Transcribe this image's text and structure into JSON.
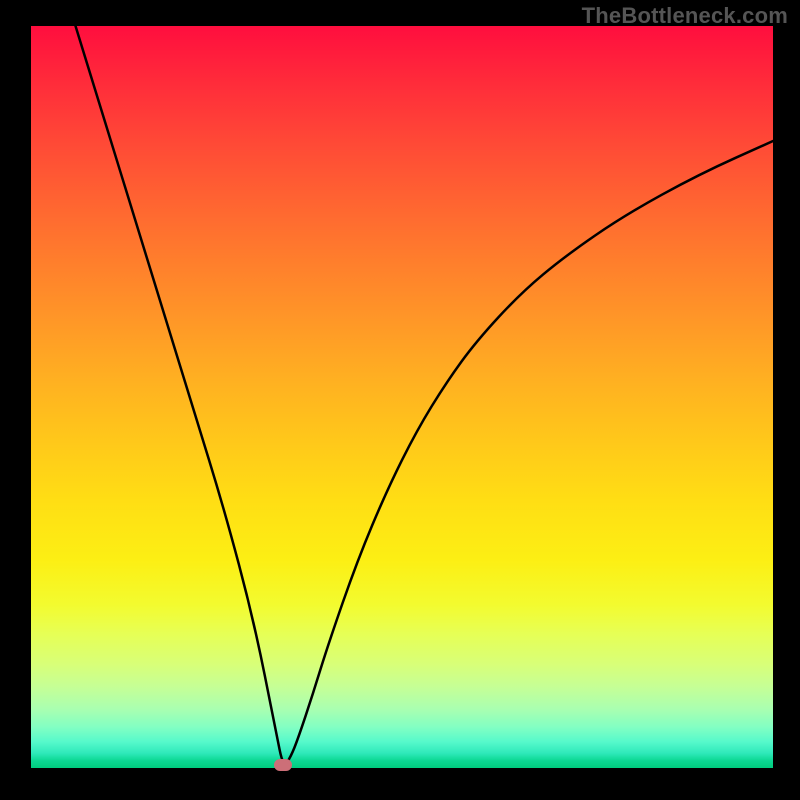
{
  "watermark": "TheBottleneck.com",
  "chart_data": {
    "type": "line",
    "title": "",
    "xlabel": "",
    "ylabel": "",
    "x_range": [
      0,
      100
    ],
    "y_range": [
      0,
      100
    ],
    "grid": false,
    "legend": false,
    "note": "V-shaped bottleneck curve. y is bottleneck % (0 = green baseline, 100 = top/red). Curve descends from top-left to a minimum near x≈34 then rises with diminishing slope toward the right.",
    "series": [
      {
        "name": "bottleneck-curve",
        "x": [
          6,
          10,
          14,
          18,
          22,
          26,
          30,
          33,
          34,
          35,
          36,
          38,
          40,
          44,
          48,
          52,
          56,
          60,
          66,
          72,
          80,
          90,
          100
        ],
        "y": [
          100,
          87,
          74,
          61,
          48,
          35,
          20,
          5,
          0,
          1.5,
          4,
          10,
          16.5,
          28,
          37.5,
          45.5,
          52,
          57.5,
          64,
          69,
          74.5,
          80,
          84.5
        ]
      }
    ],
    "min": {
      "x": 34,
      "y": 0
    },
    "marker_color": "#cc6f78",
    "curve_color": "#000000"
  }
}
